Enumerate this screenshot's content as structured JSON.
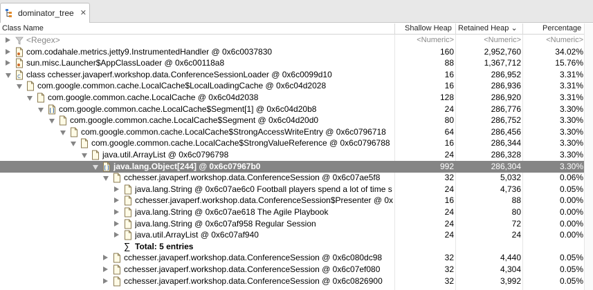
{
  "tab": {
    "title": "dominator_tree",
    "icon": "tree-view-icon",
    "close": "✕"
  },
  "columns": {
    "class_name": "Class Name",
    "shallow": "Shallow Heap",
    "retained": "Retained Heap ⌄",
    "percentage": "Percentage"
  },
  "filter": {
    "regex": "<Regex>",
    "shallow": "<Numeric>",
    "retained": "<Numeric>",
    "percentage": "<Numeric>"
  },
  "rows": [
    {
      "depth": 0,
      "expand": "right",
      "icon": "class",
      "label": "com.codahale.metrics.jetty9.InstrumentedHandler @ 0x6c0037830",
      "shallow": "160",
      "retained": "2,952,760",
      "percentage": "34.02%"
    },
    {
      "depth": 0,
      "expand": "right",
      "icon": "class",
      "label": "sun.misc.Launcher$AppClassLoader @ 0x6c00118a8",
      "shallow": "88",
      "retained": "1,367,712",
      "percentage": "15.76%"
    },
    {
      "depth": 0,
      "expand": "down",
      "icon": "class-object",
      "label": "class cchesser.javaperf.workshop.data.ConferenceSessionLoader @ 0x6c0099d10",
      "shallow": "16",
      "retained": "286,952",
      "percentage": "3.31%"
    },
    {
      "depth": 1,
      "expand": "down",
      "icon": "object",
      "label": "com.google.common.cache.LocalCache$LocalLoadingCache @ 0x6c04d2028",
      "shallow": "16",
      "retained": "286,936",
      "percentage": "3.31%"
    },
    {
      "depth": 2,
      "expand": "down",
      "icon": "object",
      "label": "com.google.common.cache.LocalCache @ 0x6c04d2038",
      "shallow": "128",
      "retained": "286,920",
      "percentage": "3.31%"
    },
    {
      "depth": 3,
      "expand": "down",
      "icon": "array",
      "label": "com.google.common.cache.LocalCache$Segment[1] @ 0x6c04d20b8",
      "shallow": "24",
      "retained": "286,776",
      "percentage": "3.30%"
    },
    {
      "depth": 4,
      "expand": "down",
      "icon": "object",
      "label": "com.google.common.cache.LocalCache$Segment @ 0x6c04d20d0",
      "shallow": "80",
      "retained": "286,752",
      "percentage": "3.30%"
    },
    {
      "depth": 5,
      "expand": "down",
      "icon": "object",
      "label": "com.google.common.cache.LocalCache$StrongAccessWriteEntry @ 0x6c0796718",
      "shallow": "64",
      "retained": "286,456",
      "percentage": "3.30%"
    },
    {
      "depth": 6,
      "expand": "down",
      "icon": "object",
      "label": "com.google.common.cache.LocalCache$StrongValueReference @ 0x6c0796788",
      "shallow": "16",
      "retained": "286,344",
      "percentage": "3.30%"
    },
    {
      "depth": 7,
      "expand": "down",
      "icon": "object",
      "label": "java.util.ArrayList @ 0x6c0796798",
      "shallow": "24",
      "retained": "286,328",
      "percentage": "3.30%"
    },
    {
      "depth": 8,
      "expand": "down",
      "icon": "array",
      "label": "java.lang.Object[244] @ 0x6c07967b0",
      "shallow": "992",
      "retained": "286,304",
      "percentage": "3.30%",
      "selected": true
    },
    {
      "depth": 9,
      "expand": "down",
      "icon": "object",
      "label": "cchesser.javaperf.workshop.data.ConferenceSession @ 0x6c07ae5f8",
      "shallow": "32",
      "retained": "5,032",
      "percentage": "0.06%"
    },
    {
      "depth": 10,
      "expand": "right",
      "icon": "object",
      "label": "java.lang.String @ 0x6c07ae6c0  Football players spend a lot of time s",
      "shallow": "24",
      "retained": "4,736",
      "percentage": "0.05%"
    },
    {
      "depth": 10,
      "expand": "right",
      "icon": "object",
      "label": "cchesser.javaperf.workshop.data.ConferenceSession$Presenter @ 0x6",
      "shallow": "16",
      "retained": "88",
      "percentage": "0.00%"
    },
    {
      "depth": 10,
      "expand": "right",
      "icon": "object",
      "label": "java.lang.String @ 0x6c07ae618  The Agile Playbook",
      "shallow": "24",
      "retained": "80",
      "percentage": "0.00%"
    },
    {
      "depth": 10,
      "expand": "right",
      "icon": "object",
      "label": "java.lang.String @ 0x6c07af958  Regular Session",
      "shallow": "24",
      "retained": "72",
      "percentage": "0.00%"
    },
    {
      "depth": 10,
      "expand": "right",
      "icon": "object",
      "label": "java.util.ArrayList @ 0x6c07af940",
      "shallow": "24",
      "retained": "24",
      "percentage": "0.00%"
    },
    {
      "depth": 10,
      "expand": "none",
      "icon": "sigma",
      "label": "Total: 5 entries",
      "shallow": "",
      "retained": "",
      "percentage": "",
      "bold": true
    },
    {
      "depth": 9,
      "expand": "right",
      "icon": "object",
      "label": "cchesser.javaperf.workshop.data.ConferenceSession @ 0x6c080dc98",
      "shallow": "32",
      "retained": "4,440",
      "percentage": "0.05%"
    },
    {
      "depth": 9,
      "expand": "right",
      "icon": "object",
      "label": "cchesser.javaperf.workshop.data.ConferenceSession @ 0x6c07ef080",
      "shallow": "32",
      "retained": "4,304",
      "percentage": "0.05%"
    },
    {
      "depth": 9,
      "expand": "right",
      "icon": "object",
      "label": "cchesser.javaperf.workshop.data.ConferenceSession @ 0x6c0826900",
      "shallow": "32",
      "retained": "3,992",
      "percentage": "0.05%"
    }
  ]
}
